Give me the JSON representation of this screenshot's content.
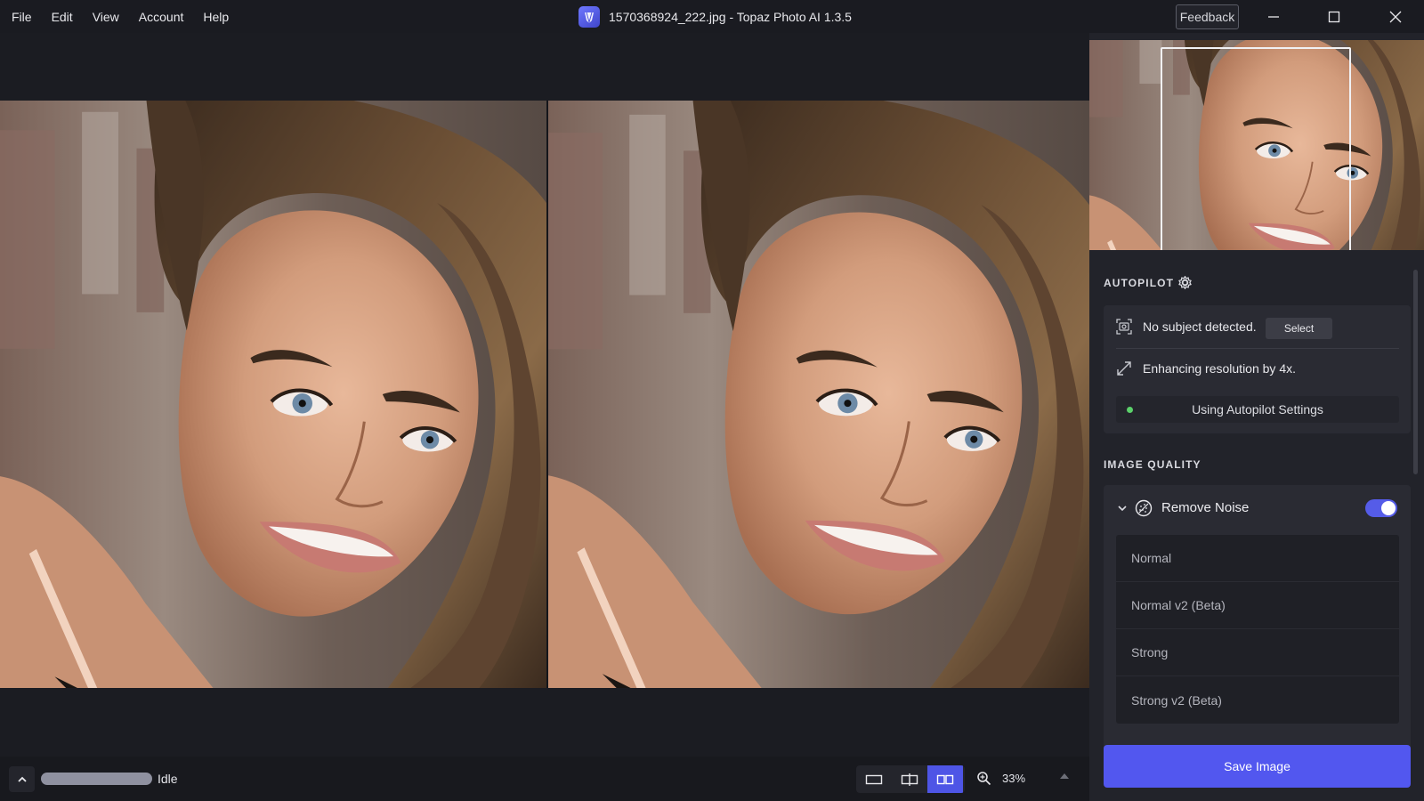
{
  "menu": {
    "items": [
      {
        "label": "File"
      },
      {
        "label": "Edit"
      },
      {
        "label": "View"
      },
      {
        "label": "Account"
      },
      {
        "label": "Help"
      }
    ]
  },
  "window": {
    "title": "1570368924_222.jpg - Topaz Photo AI 1.3.5",
    "feedback_label": "Feedback"
  },
  "autopilot": {
    "title": "AUTOPILOT",
    "subject_text": "No subject detected.",
    "select_label": "Select",
    "resolution_text": "Enhancing resolution by 4x.",
    "settings_label": "Using Autopilot Settings"
  },
  "image_quality": {
    "title": "IMAGE QUALITY",
    "remove_noise": {
      "label": "Remove Noise",
      "enabled": true,
      "models": [
        {
          "label": "Normal"
        },
        {
          "label": "Normal v2 (Beta)"
        },
        {
          "label": "Strong"
        },
        {
          "label": "Strong v2 (Beta)"
        }
      ]
    }
  },
  "actions": {
    "save_label": "Save Image"
  },
  "statusbar": {
    "status": "Idle",
    "progress": 1.0,
    "zoom": "33%",
    "active_view": "side-by-side"
  },
  "colors": {
    "accent": "#5257ef",
    "background": "#1b1c22",
    "panel": "#22232a",
    "status_dot": "#5bd16a"
  }
}
